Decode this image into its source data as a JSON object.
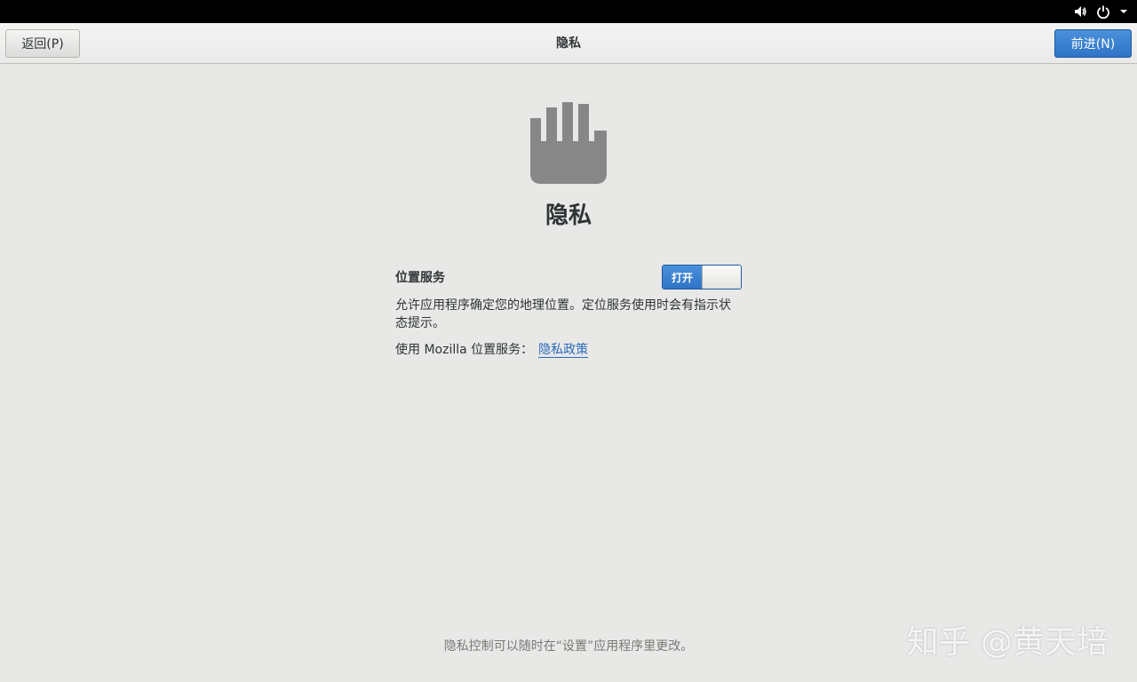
{
  "topbar": {
    "icons": [
      "volume-icon",
      "power-icon",
      "chevron-down-icon"
    ]
  },
  "header": {
    "back_label": "返回(P)",
    "title": "隐私",
    "next_label": "前进(N)"
  },
  "page": {
    "icon": "hand-icon",
    "heading": "隐私",
    "location_label": "位置服务",
    "location_switch": "打开",
    "location_enabled": true,
    "description": "允许应用程序确定您的地理位置。定位服务使用时会有指示状态提示。",
    "mozilla_prefix": "使用 Mozilla 位置服务：",
    "privacy_link": "隐私政策",
    "footer_note": "隐私控制可以随时在“设置”应用程序里更改。"
  },
  "watermark": "知乎 @黄天培",
  "colors": {
    "accent": "#2f74c8",
    "background": "#e8e8e7",
    "topbar": "#000000",
    "icon_gray": "#868786"
  }
}
